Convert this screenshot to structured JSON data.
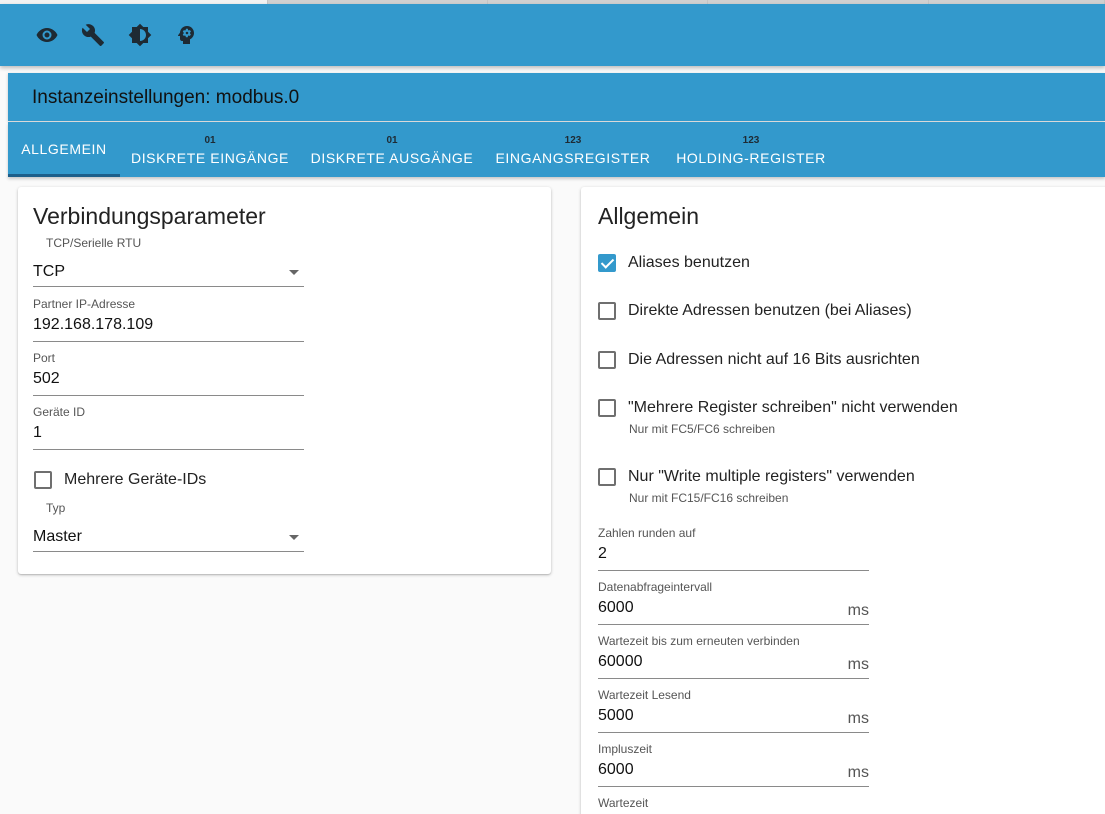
{
  "toolbar": {
    "icons": [
      "eye-icon",
      "wrench-icon",
      "brightness-icon",
      "head-icon"
    ]
  },
  "dialog": {
    "title": "Instanzeinstellungen: modbus.0"
  },
  "tabs": [
    {
      "label": "ALLGEMEIN",
      "icon": ""
    },
    {
      "label": "DISKRETE EINGÄNGE",
      "icon": "01"
    },
    {
      "label": "DISKRETE AUSGÄNGE",
      "icon": "01"
    },
    {
      "label": "EINGANGSREGISTER",
      "icon": "123"
    },
    {
      "label": "HOLDING-REGISTER",
      "icon": "123"
    }
  ],
  "left": {
    "title": "Verbindungsparameter",
    "type_select": {
      "label": "TCP/Serielle RTU",
      "value": "TCP"
    },
    "ip": {
      "label": "Partner IP-Adresse",
      "value": "192.168.178.109"
    },
    "port": {
      "label": "Port",
      "value": "502"
    },
    "device_id": {
      "label": "Geräte ID",
      "value": "1"
    },
    "multi_ids": {
      "label": "Mehrere Geräte-IDs",
      "checked": false
    },
    "role_select": {
      "label": "Typ",
      "value": "Master"
    }
  },
  "right": {
    "title": "Allgemein",
    "checks": [
      {
        "label": "Aliases benutzen",
        "checked": true,
        "help": ""
      },
      {
        "label": "Direkte Adressen benutzen (bei Aliases)",
        "checked": false,
        "help": ""
      },
      {
        "label": "Die Adressen nicht auf 16 Bits ausrichten",
        "checked": false,
        "help": ""
      },
      {
        "label": "\"Mehrere Register schreiben\" nicht verwenden",
        "checked": false,
        "help": "Nur mit FC5/FC6 schreiben"
      },
      {
        "label": "Nur \"Write multiple registers\" verwenden",
        "checked": false,
        "help": "Nur mit FC15/FC16 schreiben"
      }
    ],
    "fields": [
      {
        "label": "Zahlen runden auf",
        "value": "2",
        "unit": ""
      },
      {
        "label": "Datenabfrageintervall",
        "value": "6000",
        "unit": "ms"
      },
      {
        "label": "Wartezeit bis zum erneuten verbinden",
        "value": "60000",
        "unit": "ms"
      },
      {
        "label": "Wartezeit Lesend",
        "value": "5000",
        "unit": "ms"
      },
      {
        "label": "Impluszeit",
        "value": "6000",
        "unit": "ms"
      },
      {
        "label": "Wartezeit",
        "value": "",
        "unit": ""
      }
    ]
  },
  "colors": {
    "primary": "#3399cc",
    "indicator": "#1d5f8a",
    "text": "#222222"
  }
}
